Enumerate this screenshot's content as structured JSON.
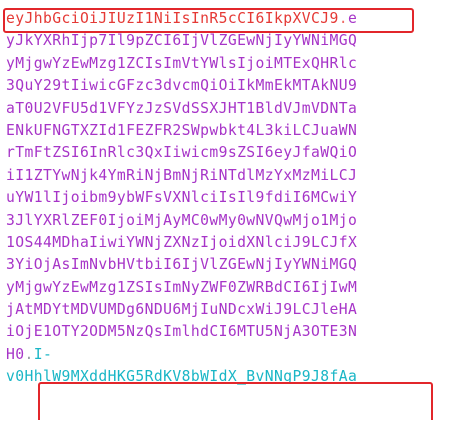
{
  "token": {
    "header": "eyJhbGciOiJIUzI1NiIsInR5cCI6IkpXVCJ9",
    "dot1": ".",
    "payload_lines": [
      "e",
      "yJkYXRhIjp7Il9pZCI6IjVlZGEwNjIyYWNiMGQ",
      "yMjgwYzEwMzg1ZCIsImVtYWlsIjoiMTExQHRlc",
      "3QuY29tIiwicGFzc3dvcmQiOiIkMmEkMTAkNU9",
      "aT0U2VFU5d1VFYzJzSVdSSXJHT1BldVJmVDNTa",
      "ENkUFNGTXZId1FEZFR2SWpwbkt4L3kiLCJuaWN",
      "rTmFtZSI6InRlc3QxIiwicm9sZSI6eyJfaWQiO",
      "iI1ZTYwNjk4YmRiNjBmNjRiNTdlMzYxMzMiLCJ",
      "uYW1lIjoibm9ybWFsVXNlciIsIl9fdiI6MCwiY",
      "3JlYXRlZEF0IjoiMjAyMC0wMy0wNVQwMjo1Mjo",
      "1OS44MDhaIiwiYWNjZXNzIjoidXNlciJ9LCJfX",
      "3YiOjAsImNvbHVtbiI6IjVlZGEwNjIyYWNiMGQ",
      "yMjgwYzEwMzg1ZSIsImNyZWF0ZWRBdCI6IjIwM",
      "jAtMDYtMDVUMDg6NDU6MjIuNDcxWiJ9LCJleHA",
      "iOjE1OTY2ODM5NzQsImlhdCI6MTU5NjA3OTE3N",
      "H0"
    ],
    "dot2": ".",
    "signature_lines": [
      "I-",
      "v0HhlW9MXddHKG5RdKV8bWIdX_BvNNgP9J8fAa"
    ]
  },
  "colors": {
    "header": "#e53935",
    "payload": "#a735c8",
    "signature": "#19b6c6",
    "highlight": "#e2262b"
  }
}
